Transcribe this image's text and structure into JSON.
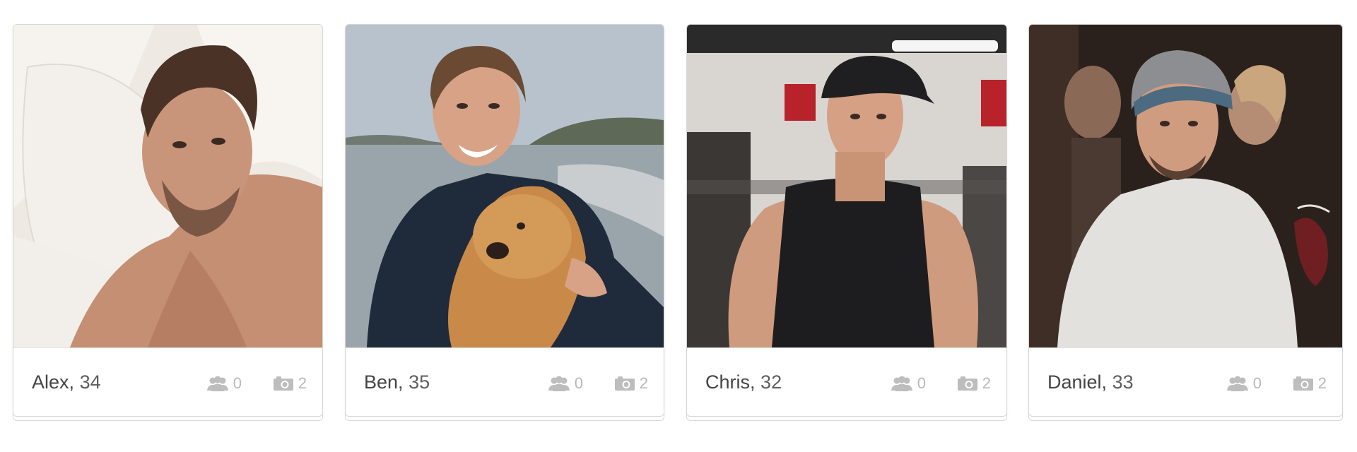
{
  "profiles": [
    {
      "name": "Alex",
      "age": "34",
      "friends": "0",
      "photos": "2",
      "sep": ","
    },
    {
      "name": "Ben",
      "age": "35",
      "friends": "0",
      "photos": "2",
      "sep": ","
    },
    {
      "name": "Chris",
      "age": "32",
      "friends": "0",
      "photos": "2",
      "sep": ","
    },
    {
      "name": "Daniel",
      "age": "33",
      "friends": "0",
      "photos": "2",
      "sep": ","
    }
  ],
  "icons": {
    "friends": "friends-icon",
    "photos": "camera-icon"
  },
  "colors": {
    "card_border": "#d6d6d6",
    "name_text": "#444444",
    "stat_text": "#b9b9b9"
  }
}
